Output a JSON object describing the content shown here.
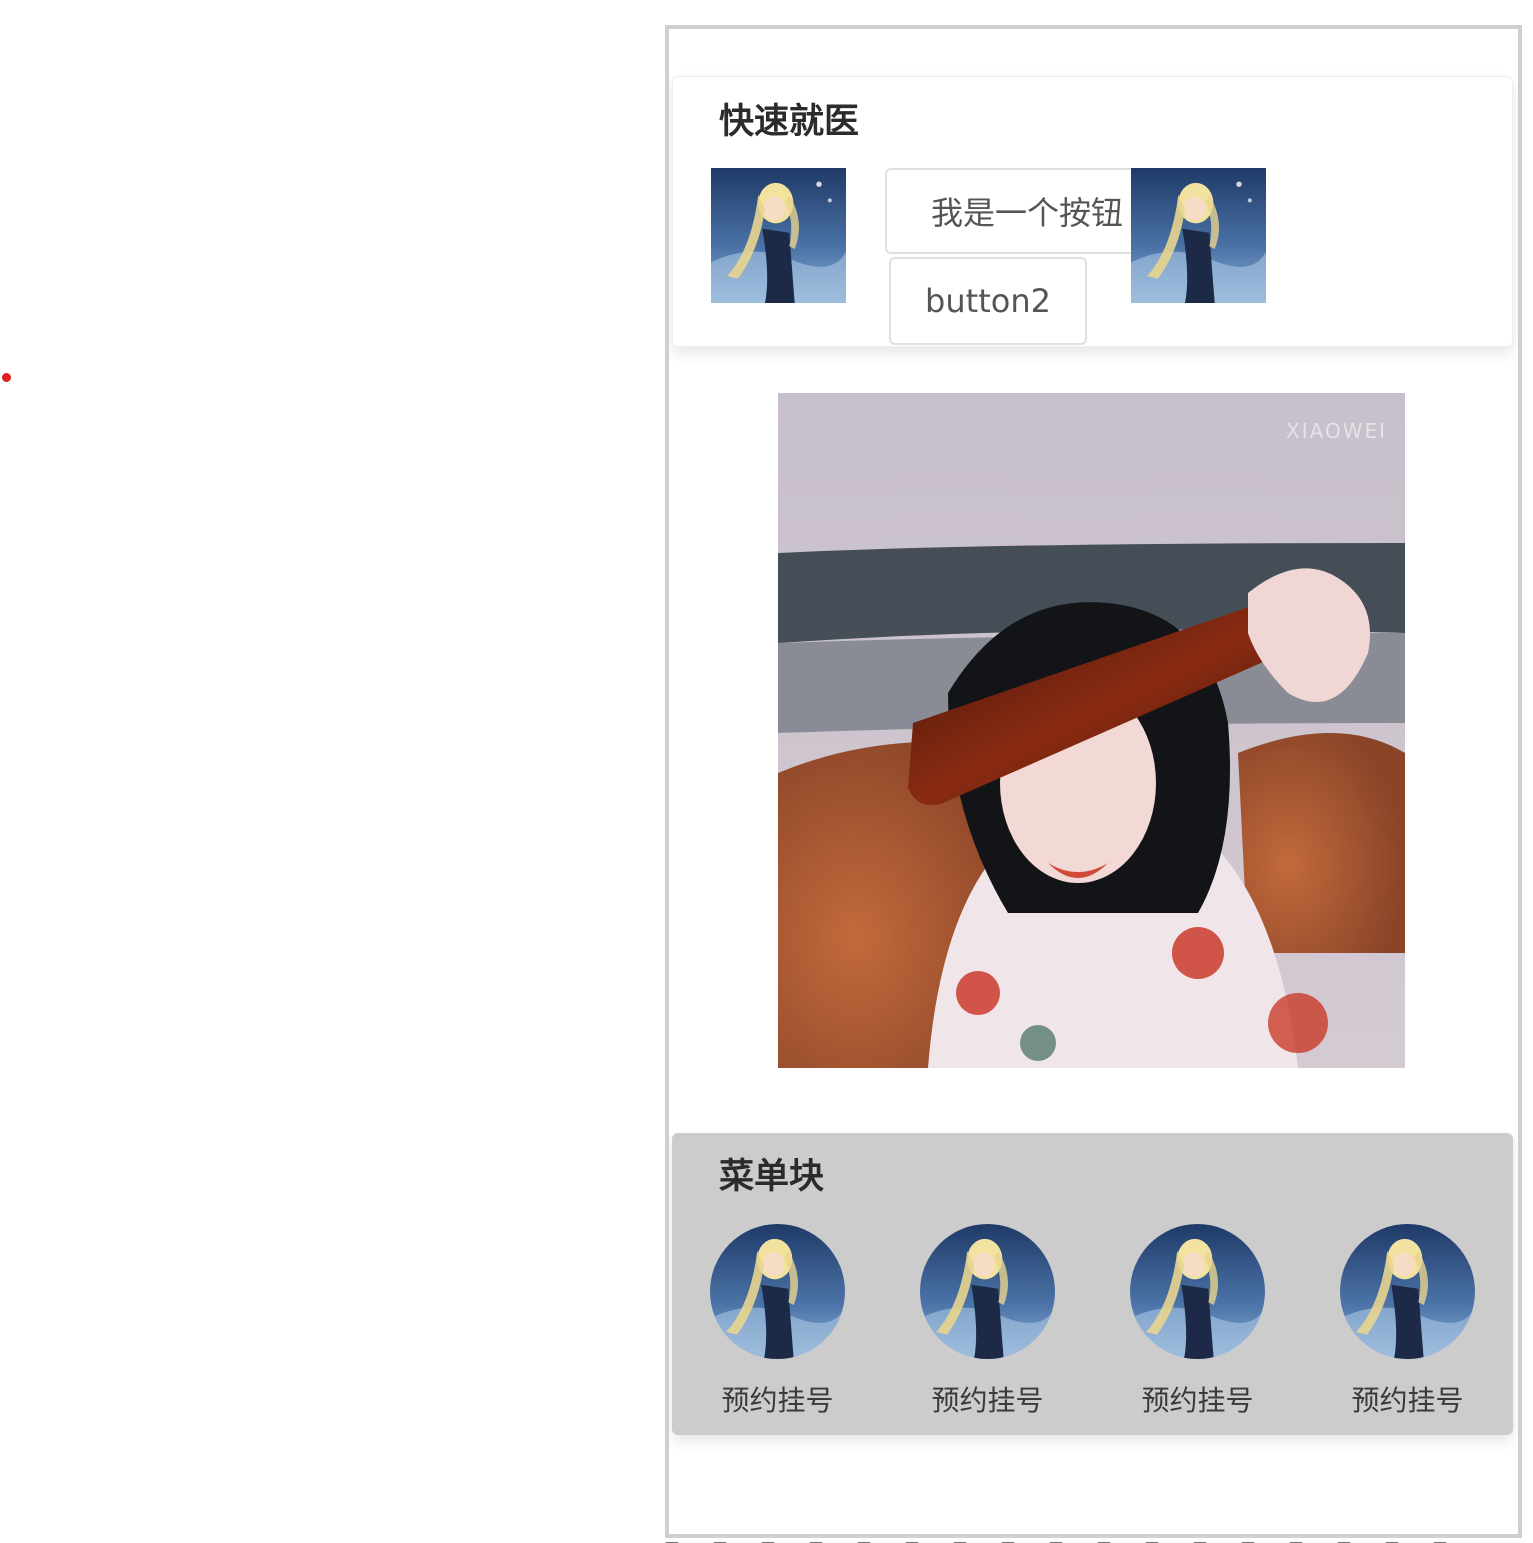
{
  "quick_card": {
    "title": "快速就医",
    "button_1_label": "我是一个按钮",
    "button_2_label": "button2",
    "thumb_icon": "anime-avatar-thumbnail"
  },
  "photo": {
    "watermark": "XIAOWEI"
  },
  "menu_card": {
    "title": "菜单块",
    "items": [
      {
        "label": "预约挂号",
        "icon": "anime-avatar-thumbnail"
      },
      {
        "label": "预约挂号",
        "icon": "anime-avatar-thumbnail"
      },
      {
        "label": "预约挂号",
        "icon": "anime-avatar-thumbnail"
      },
      {
        "label": "预约挂号",
        "icon": "anime-avatar-thumbnail"
      }
    ],
    "background_color": "#cccccc"
  },
  "colors": {
    "frame_border": "#cfcfcf",
    "indicator_dot": "#e02020"
  }
}
